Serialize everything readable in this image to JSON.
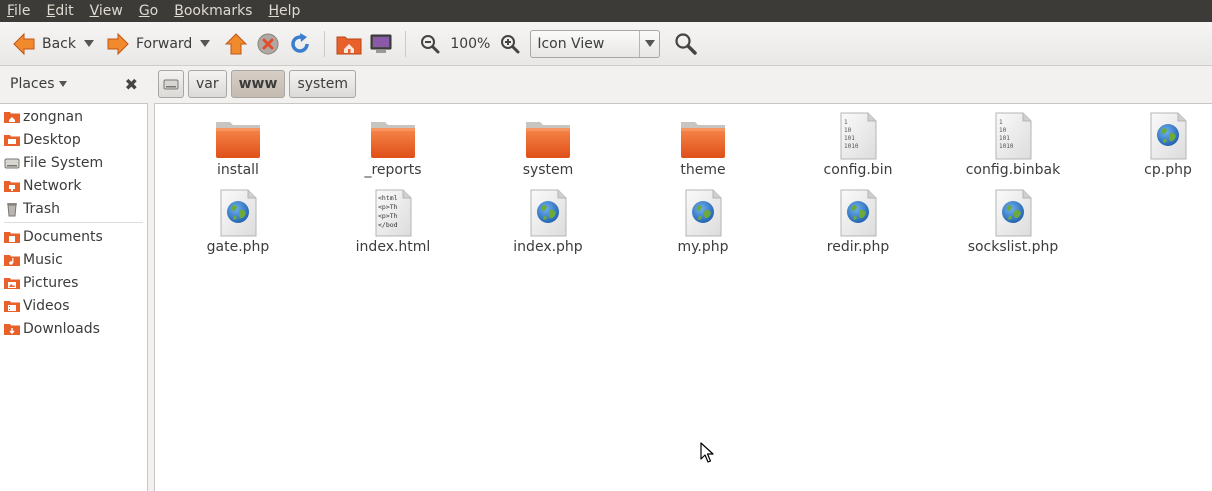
{
  "menubar": {
    "items": [
      {
        "mn": "F",
        "rest": "ile"
      },
      {
        "mn": "E",
        "rest": "dit"
      },
      {
        "mn": "V",
        "rest": "iew"
      },
      {
        "mn": "G",
        "rest": "o"
      },
      {
        "mn": "B",
        "rest": "ookmarks"
      },
      {
        "mn": "H",
        "rest": "elp"
      }
    ]
  },
  "toolbar": {
    "back_label": "Back",
    "forward_label": "Forward",
    "zoom_level": "100%",
    "view_mode": "Icon View"
  },
  "places": {
    "title": "Places",
    "close_glyph": "✖"
  },
  "pathbar": {
    "segments": [
      "var",
      "www",
      "system"
    ],
    "active": "www"
  },
  "sidebar": {
    "group1": [
      "zongnan",
      "Desktop",
      "File System",
      "Network",
      "Trash"
    ],
    "group2": [
      "Documents",
      "Music",
      "Pictures",
      "Videos",
      "Downloads"
    ]
  },
  "files": {
    "row1": [
      "install",
      "_reports",
      "system",
      "theme",
      "config.bin",
      "config.binbak",
      "cp.php"
    ],
    "row2": [
      "gate.php",
      "index.html",
      "index.php",
      "my.php",
      "redir.php",
      "sockslist.php"
    ],
    "binary_icon_text": [
      "1",
      "10",
      "101",
      "1010"
    ],
    "html_icon_text": [
      "<html",
      "<p>Th",
      "<p>Th",
      "</bod"
    ]
  },
  "colors": {
    "menubar_bg": "#3c3b37",
    "folder_orange": "#e9612a",
    "accent_orange": "#f07c2c"
  }
}
